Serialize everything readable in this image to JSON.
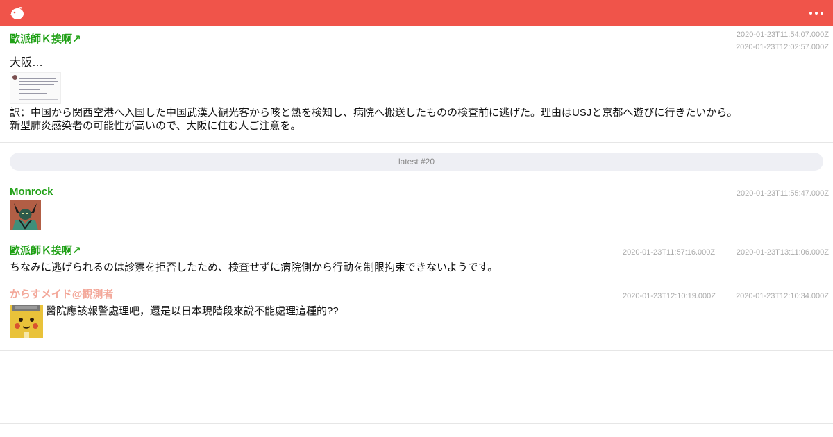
{
  "colors": {
    "header": "#f0544a",
    "username_green": "#21a117",
    "username_pink": "#f3a89a",
    "timestamp": "#aaaaaa"
  },
  "header": {
    "logo_icon": "bird-logo-icon",
    "menu_icon": "more-horizontal-icon"
  },
  "posts": [
    {
      "user": "歐派師Ｋ挨啊↗",
      "timestamps": [
        "2020-01-23T11:54:07.000Z",
        "2020-01-23T12:02:57.000Z"
      ],
      "title": "大阪…",
      "body_lines": [
        "訳：中国から関西空港へ入国した中国武漢人観光客から咳と熱を検知し、病院へ搬送したものの検査前に逃げた。理由はUSJと京都へ遊びに行きたいから。",
        "新型肺炎感染者の可能性が高いので、大阪に住む人ご注意を。"
      ]
    }
  ],
  "latest_bar": {
    "label": "latest #20"
  },
  "replies": [
    {
      "user": "Monrock",
      "timestamps": [
        "2020-01-23T11:55:47.000Z"
      ],
      "text": ""
    },
    {
      "user": "歐派師Ｋ挨啊↗",
      "timestamps": [
        "2020-01-23T11:57:16.000Z",
        "2020-01-23T13:11:06.000Z"
      ],
      "text": "ちなみに逃げられるのは診察を拒否したため、検査せずに病院側から行動を制限拘束できないようです。"
    },
    {
      "user": "からすメイド@観測者",
      "timestamps": [
        "2020-01-23T12:10:19.000Z",
        "2020-01-23T12:10:34.000Z"
      ],
      "text": "醫院應該報警處理吧，還是以日本現階段來說不能處理這種的??"
    }
  ],
  "bottom": {
    "partial_user": "",
    "partial_icon": "cut-off-username"
  }
}
